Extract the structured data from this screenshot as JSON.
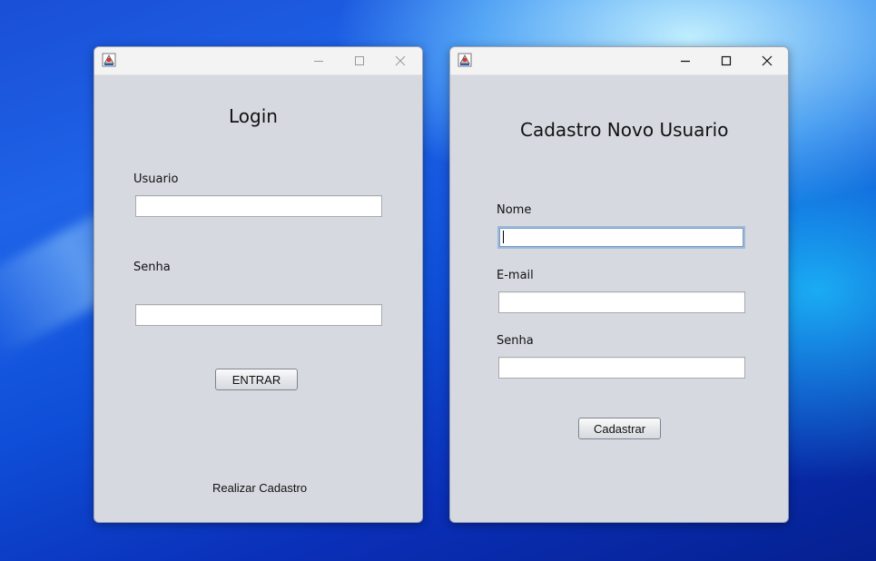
{
  "login_window": {
    "heading": "Login",
    "usuario_label": "Usuario",
    "usuario_value": "",
    "senha_label": "Senha",
    "senha_value": "",
    "enter_button": "ENTRAR",
    "register_link": "Realizar Cadastro"
  },
  "register_window": {
    "heading": "Cadastro Novo Usuario",
    "nome_label": "Nome",
    "nome_value": "",
    "email_label": "E-mail",
    "email_value": "",
    "senha_label": "Senha",
    "senha_value": "",
    "submit_button": "Cadastrar"
  },
  "icons": {
    "app": "java-app-icon",
    "minimize": "minimize-icon",
    "maximize": "maximize-icon",
    "close": "close-icon"
  }
}
